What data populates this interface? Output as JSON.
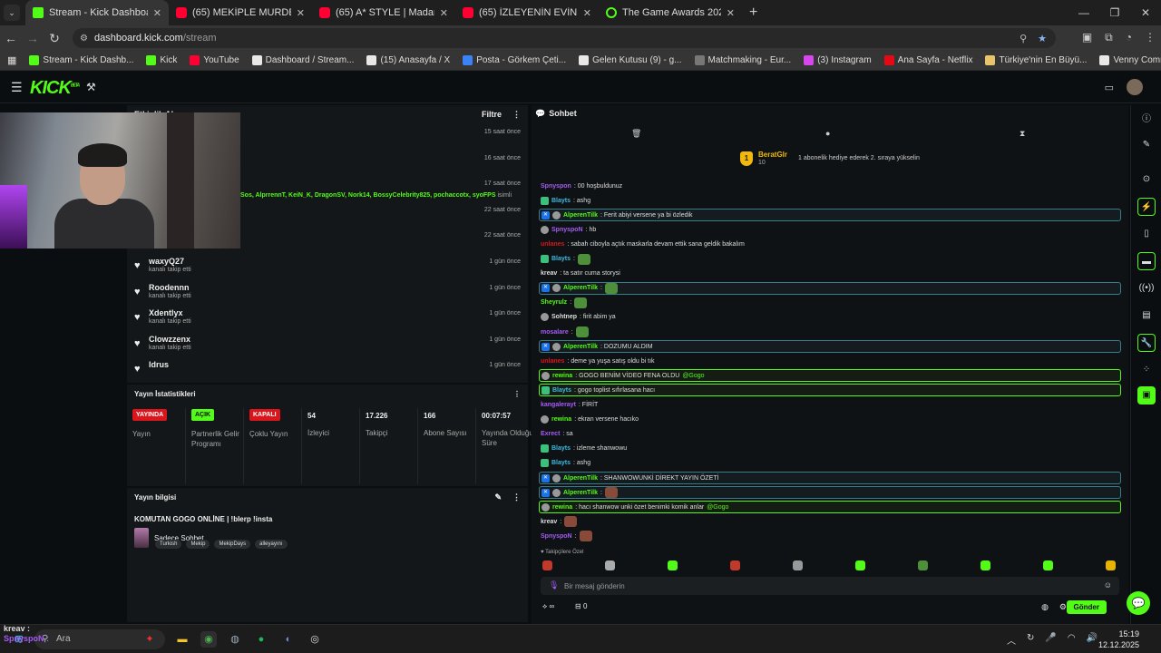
{
  "browser": {
    "tabs": [
      {
        "title": "Stream - Kick Dashboard",
        "fav": "kick",
        "active": true
      },
      {
        "title": "(65) MEKİPLE MURDER KOMİK /",
        "fav": "yt"
      },
      {
        "title": "(65) A* STYLE | Madara Olduk #",
        "fav": "yt"
      },
      {
        "title": "(65) İZLEYENİN EVİNE DÖŞEYEN",
        "fav": "yt"
      },
      {
        "title": "The Game Awards 2025 ödüller",
        "fav": "ga"
      }
    ],
    "url_host": "dashboard.kick.com",
    "url_path": "/stream",
    "bookmarks": [
      {
        "label": "Stream - Kick Dashb...",
        "color": "#53fc18"
      },
      {
        "label": "Kick",
        "color": "#53fc18"
      },
      {
        "label": "YouTube",
        "color": "#ff0033"
      },
      {
        "label": "Dashboard / Stream...",
        "color": "#e8e8e8"
      },
      {
        "label": "(15) Anasayfa / X",
        "color": "#e8e8e8"
      },
      {
        "label": "Posta - Görkem Çeti...",
        "color": "#3b82f6"
      },
      {
        "label": "Gelen Kutusu (9) - g...",
        "color": "#e8e8e8"
      },
      {
        "label": "Matchmaking - Eur...",
        "color": "#777777"
      },
      {
        "label": "(3) Instagram",
        "color": "#d946ef"
      },
      {
        "label": "Ana Sayfa - Netflix",
        "color": "#e50914"
      },
      {
        "label": "Türkiye'nin En Büyü...",
        "color": "#e9c46a"
      },
      {
        "label": "Venny Community",
        "color": "#e8e8e8"
      }
    ]
  },
  "activity": {
    "title": "Etkinlik Akışı",
    "filter": "Filtre",
    "gift_names": "Sos, AlprrennT, KeiN_K, DragonSV, Nork14, BossyCelebrity825, pochaccotx, syoFPS",
    "gift_suffix": " isimli",
    "rows": [
      {
        "name": "",
        "sub": "",
        "time": "15 saat önce"
      },
      {
        "name": "",
        "sub": "",
        "time": "16 saat önce"
      },
      {
        "name": "",
        "sub": "",
        "time": "17 saat önce"
      },
      {
        "name": "",
        "sub": "",
        "time": "22 saat önce"
      },
      {
        "name": "",
        "sub": "kanalı takip etti",
        "time": "22 saat önce"
      },
      {
        "name": "waxyQ27",
        "sub": "kanalı takip etti",
        "time": "1 gün önce"
      },
      {
        "name": "Roodennn",
        "sub": "kanalı takip etti",
        "time": "1 gün önce"
      },
      {
        "name": "Xdentlyx",
        "sub": "kanalı takip etti",
        "time": "1 gün önce"
      },
      {
        "name": "Clowzzenx",
        "sub": "kanalı takip etti",
        "time": "1 gün önce"
      },
      {
        "name": "Idrus",
        "sub": "",
        "time": "1 gün önce"
      }
    ]
  },
  "stats": {
    "title": "Yayın İstatistikleri",
    "cells": [
      {
        "badge": "YAYINDA",
        "kind": "red",
        "label": "Yayın"
      },
      {
        "badge": "AÇIK",
        "kind": "green",
        "label": "Partnerlik Gelir Programı"
      },
      {
        "badge": "KAPALI",
        "kind": "red",
        "label": "Çoklu Yayın"
      },
      {
        "num": "54",
        "label": "İzleyici"
      },
      {
        "num": "17.226",
        "label": "Takipçi"
      },
      {
        "num": "166",
        "label": "Abone Sayısı"
      },
      {
        "num": "00:07:57",
        "label": "Yayında Olduğu Süre"
      }
    ]
  },
  "info": {
    "title": "Yayın bilgisi",
    "stream_title": "KOMUTAN GOGO ONLİNE | !blerp !insta",
    "category": "Sadece Sohbet",
    "tags": [
      "Turkish",
      "Mekip",
      "MekipDays",
      "alleyayını"
    ]
  },
  "chat": {
    "title": "Sohbet",
    "pinned_user": "BeratGlr",
    "pinned_rank": "1",
    "pinned_sub": "10",
    "pinned_msg": "1 abonelik hediye ederek 2. sıraya yükselin",
    "messages": [
      {
        "user": "Spnyspon",
        "color": "#a55cf5",
        "text": ": 00 hoşbuldunuz",
        "hl": "",
        "badge": ""
      },
      {
        "user": "Blayts",
        "color": "#3fb9e0",
        "text": ": ashg",
        "hl": "",
        "badge": "g"
      },
      {
        "user": "AlperenTilk",
        "color": "#53fc18",
        "text": ": Ferit abiyi versene ya bi özledik",
        "hl": "blue",
        "badge": "b"
      },
      {
        "user": "SpnyspoN",
        "color": "#a55cf5",
        "text": ": hb",
        "hl": "",
        "badge": "a"
      },
      {
        "user": "unlanes",
        "color": "#d9161b",
        "text": ": sabah ciboyla açtık maskarla devam ettik sana geldik bakalım",
        "hl": "",
        "badge": ""
      },
      {
        "user": "Blayts",
        "color": "#3fb9e0",
        "text": ":",
        "hl": "",
        "badge": "g",
        "emote": "g"
      },
      {
        "user": "kreav",
        "color": "#dddddd",
        "text": ": ta satır cuma storysi",
        "hl": "",
        "badge": ""
      },
      {
        "user": "AlperenTilk",
        "color": "#53fc18",
        "text": ":",
        "hl": "blue",
        "badge": "b",
        "emote": "g"
      },
      {
        "user": "Sheyrulz",
        "color": "#53fc18",
        "text": ":",
        "hl": "",
        "badge": "",
        "emote": "g"
      },
      {
        "user": "Sohtnep",
        "color": "#dddddd",
        "text": ": firit abim ya",
        "hl": "",
        "badge": "a"
      },
      {
        "user": "mosalare",
        "color": "#a55cf5",
        "text": ":",
        "hl": "",
        "badge": "",
        "emote": "g"
      },
      {
        "user": "AlperenTilk",
        "color": "#53fc18",
        "text": ": DOZUMU ALDIM",
        "hl": "blue",
        "badge": "b"
      },
      {
        "user": "unlanes",
        "color": "#d9161b",
        "text": ": deme ya yuşa satış oldu bi tık",
        "hl": "",
        "badge": ""
      },
      {
        "user": "rewina",
        "color": "#53fc18",
        "text": ": GOGO BENİM VİDEO FENA OLDU",
        "hl": "green",
        "badge": "a",
        "mention": " @Gogo"
      },
      {
        "user": "Blayts",
        "color": "#3fb9e0",
        "text": ": gogo toplist sıfırlasana hacı",
        "hl": "green",
        "badge": "g"
      },
      {
        "user": "kangalerayt",
        "color": "#a55cf5",
        "text": ": FİRİT",
        "hl": "",
        "badge": ""
      },
      {
        "user": "rewina",
        "color": "#53fc18",
        "text": ": ekran versene hacıko",
        "hl": "",
        "badge": "a"
      },
      {
        "user": "Exrect",
        "color": "#a55cf5",
        "text": ": sa",
        "hl": "",
        "badge": ""
      },
      {
        "user": "Blayts",
        "color": "#3fb9e0",
        "text": ": izleme shanwowu",
        "hl": "",
        "badge": "g"
      },
      {
        "user": "Blayts",
        "color": "#3fb9e0",
        "text": ": ashg",
        "hl": "",
        "badge": "g"
      },
      {
        "user": "AlperenTilk",
        "color": "#53fc18",
        "text": ": SHANWOWUNKİ DİREKT YAYIN ÖZETİ",
        "hl": "blue",
        "badge": "b"
      },
      {
        "user": "AlperenTilk",
        "color": "#53fc18",
        "text": ":",
        "hl": "blue",
        "badge": "b",
        "emote": "br"
      },
      {
        "user": "rewina",
        "color": "#53fc18",
        "text": ": hacı shanwow unki özet benimki komik anlar",
        "hl": "green",
        "badge": "a",
        "mention": " @Gogo"
      },
      {
        "user": "kreav",
        "color": "#dddddd",
        "text": ":",
        "hl": "",
        "badge": "",
        "emote": "br"
      },
      {
        "user": "SpnyspoN",
        "color": "#a55cf5",
        "text": ":",
        "hl": "",
        "badge": "",
        "emote": "br"
      }
    ],
    "followers_label": "Takipçilere Özel",
    "input_placeholder": "Bir mesaj gönderin",
    "points": "0",
    "send": "Gönder"
  },
  "overlay": {
    "line1": "kreav :",
    "line2": "SpnyspoN :"
  },
  "taskbar": {
    "search": "Ara",
    "time": "15:19",
    "date": "12.12.2025"
  }
}
